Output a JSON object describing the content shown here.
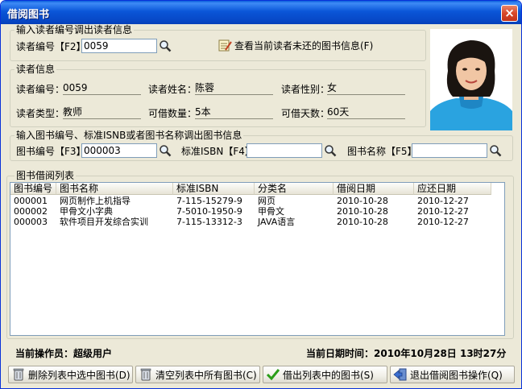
{
  "window": {
    "title": "借阅图书",
    "close": "×"
  },
  "reader_search": {
    "group_title": "输入读者编号调出读者信息",
    "id_label": "读者编号【F2】",
    "id_value": "0059",
    "unreturned_link": "查看当前读者未还的图书信息(F)"
  },
  "reader_info": {
    "group_title": "读者信息",
    "number_label": "读者编号：",
    "number_value": "0059",
    "name_label": "读者姓名：",
    "name_value": "陈蓉",
    "gender_label": "读者性别：",
    "gender_value": "女",
    "type_label": "读者类型：",
    "type_value": "教师",
    "quota_label": "可借数量：",
    "quota_value": "5本",
    "days_label": "可借天数：",
    "days_value": "60天"
  },
  "book_search": {
    "group_title": "输入图书编号、标准ISNB或者图书名称调出图书信息",
    "book_no_label": "图书编号【F3】",
    "book_no_value": "000003",
    "isbn_label": "标准ISBN【F4】",
    "isbn_value": "",
    "book_name_label": "图书名称【F5】",
    "book_name_value": ""
  },
  "borrow_list": {
    "group_title": "图书借阅列表",
    "columns": [
      "图书编号",
      "图书名称",
      "标准ISBN",
      "分类名",
      "借阅日期",
      "应还日期"
    ],
    "rows": [
      [
        "000001",
        "网页制作上机指导",
        "7-115-15279-9",
        "网页",
        "2010-10-28",
        "2010-12-27"
      ],
      [
        "000002",
        "甲骨文小字典",
        "7-5010-1950-9",
        "甲骨文",
        "2010-10-28",
        "2010-12-27"
      ],
      [
        "000003",
        "软件项目开发综合实训",
        "7-115-13312-3",
        "JAVA语言",
        "2010-10-28",
        "2010-12-27"
      ]
    ]
  },
  "status": {
    "operator": "当前操作员：超级用户",
    "datetime": "当前日期时间：2010年10月28日 13时27分"
  },
  "buttons": {
    "delete_selected": "删除列表中选中图书(D)",
    "clear_all": "清空列表中所有图书(C)",
    "borrow": "借出列表中的图书(S)",
    "exit": "退出借阅图书操作(Q)"
  },
  "colors": {
    "title_bar": "#0a56d8",
    "frame": "#ece9d8",
    "field_border": "#7f9db9",
    "check_green": "#2a9d18",
    "photo_bg": "#2aa3e0"
  },
  "icons": {
    "search": "magnifier-icon",
    "notepad": "notepad-icon",
    "trash": "trash-icon",
    "check": "check-icon",
    "exit": "exit-icon"
  }
}
